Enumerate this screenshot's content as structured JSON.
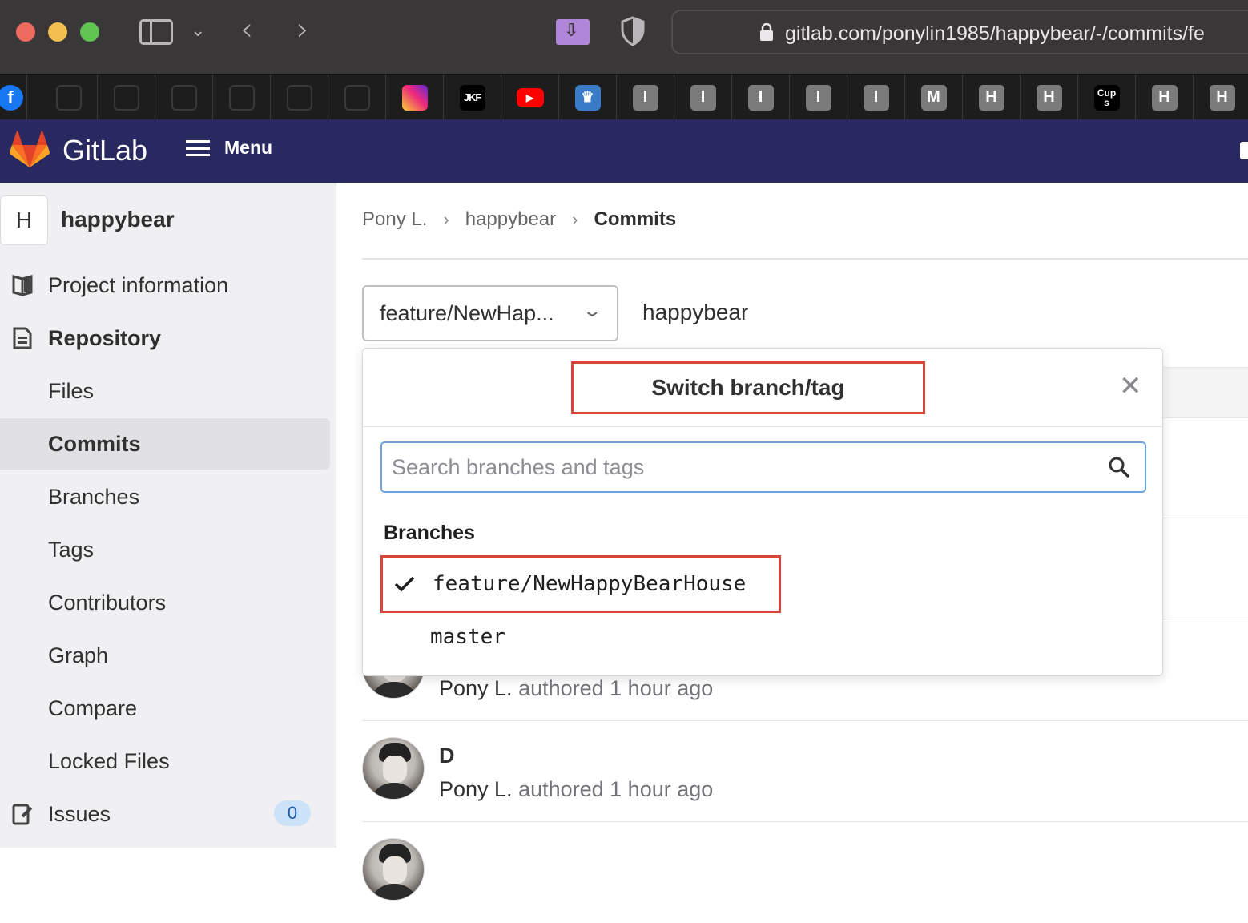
{
  "browser": {
    "url": "gitlab.com/ponylin1985/happybear/-/commits/fe",
    "favorites": [
      {
        "icon": "facebook-icon",
        "label": "f"
      },
      {
        "icon": "instagram-dim-icon",
        "label": ""
      },
      {
        "icon": "instagram-dim-icon",
        "label": ""
      },
      {
        "icon": "instagram-dim-icon",
        "label": ""
      },
      {
        "icon": "instagram-dim-icon",
        "label": ""
      },
      {
        "icon": "instagram-dim-icon",
        "label": ""
      },
      {
        "icon": "instagram-dim-icon",
        "label": ""
      },
      {
        "icon": "instagram-icon",
        "label": ""
      },
      {
        "icon": "jkf-icon",
        "label": "JKF"
      },
      {
        "icon": "youtube-icon",
        "label": "▶"
      },
      {
        "icon": "crown-icon",
        "label": "♛"
      },
      {
        "icon": "letter-icon",
        "label": "I"
      },
      {
        "icon": "letter-icon",
        "label": "I"
      },
      {
        "icon": "letter-icon",
        "label": "I"
      },
      {
        "icon": "letter-icon",
        "label": "I"
      },
      {
        "icon": "letter-icon",
        "label": "I"
      },
      {
        "icon": "letter-icon",
        "label": "M"
      },
      {
        "icon": "letter-icon",
        "label": "H"
      },
      {
        "icon": "letter-icon",
        "label": "H"
      },
      {
        "icon": "cups-icon",
        "label": "Cup s"
      },
      {
        "icon": "letter-icon",
        "label": "H"
      },
      {
        "icon": "letter-icon",
        "label": "H"
      }
    ]
  },
  "header": {
    "brand": "GitLab",
    "menu_label": "Menu"
  },
  "sidebar": {
    "project_initial": "H",
    "project_name": "happybear",
    "items": [
      {
        "label": "Project information",
        "icon": "book-icon"
      },
      {
        "label": "Repository",
        "icon": "document-icon"
      },
      {
        "label": "Files"
      },
      {
        "label": "Commits"
      },
      {
        "label": "Branches"
      },
      {
        "label": "Tags"
      },
      {
        "label": "Contributors"
      },
      {
        "label": "Graph"
      },
      {
        "label": "Compare"
      },
      {
        "label": "Locked Files"
      },
      {
        "label": "Issues",
        "icon": "issues-icon",
        "badge": "0"
      }
    ]
  },
  "main": {
    "breadcrumb": [
      "Pony L.",
      "happybear",
      "Commits"
    ],
    "branch_select_value": "feature/NewHap...",
    "repo_name": "happybear",
    "commits": [
      {
        "title": "",
        "author": "Pony L.",
        "meta": "authored 1 hour ago"
      },
      {
        "title": "D",
        "author": "Pony L.",
        "meta": "authored 1 hour ago"
      }
    ]
  },
  "dropdown": {
    "title": "Switch branch/tag",
    "search_placeholder": "Search branches and tags",
    "section_label": "Branches",
    "branches": [
      {
        "name": "feature/NewHappyBearHouse",
        "selected": true
      },
      {
        "name": "master",
        "selected": false
      }
    ]
  },
  "colors": {
    "header_bg": "#292961",
    "annotation_red": "#d9453a",
    "search_focus": "#6da3df",
    "badge_bg": "#cbe2f9"
  }
}
